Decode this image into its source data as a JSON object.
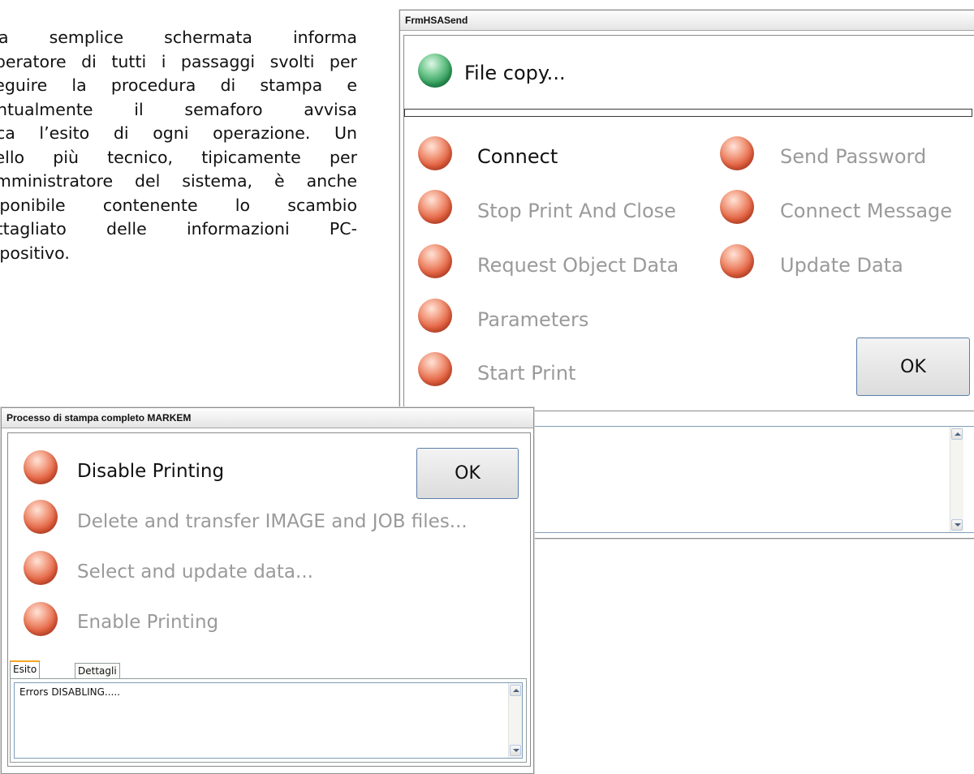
{
  "doc": {
    "lines": [
      "Una semplice schermata informa",
      "l'operatore di tutti i passaggi svolti per",
      "eseguire la procedura di stampa e",
      "puntualmente il semaforo avvisa",
      "circa l’esito di ogni operazione. Un",
      "livello più tecnico, tipicamente per",
      "l'amministratore del sistema, è anche",
      "disponibile contenente lo scambio",
      "dettagliato delle informazioni PC-",
      "dispositivo."
    ]
  },
  "hsa_window": {
    "title": "FrmHSASend",
    "file_copy": {
      "label": "File copy...",
      "status": "green"
    },
    "progress": 0,
    "steps": [
      {
        "label": "Connect",
        "state": "active"
      },
      {
        "label": "Send Password",
        "state": "dim"
      },
      {
        "label": "Stop Print And Close",
        "state": "dim"
      },
      {
        "label": "Connect Message",
        "state": "dim"
      },
      {
        "label": "Request Object Data",
        "state": "dim"
      },
      {
        "label": "Update Data",
        "state": "dim"
      },
      {
        "label": "Parameters",
        "state": "dim"
      },
      {
        "label": "Start Print",
        "state": "dim"
      }
    ],
    "ok_label": "OK",
    "log_text": ""
  },
  "markem_window": {
    "title": "Processo di stampa completo MARKEM",
    "steps": [
      {
        "label": "Disable Printing",
        "state": "active"
      },
      {
        "label": "Delete and transfer IMAGE and JOB files...",
        "state": "dim"
      },
      {
        "label": "Select and update data...",
        "state": "dim"
      },
      {
        "label": "Enable Printing",
        "state": "dim"
      }
    ],
    "ok_label": "OK",
    "tabs": [
      {
        "label": "Esito",
        "selected": true
      },
      {
        "label": "Dettagli",
        "selected": false
      }
    ],
    "log_text": "Errors DISABLING....."
  },
  "colors": {
    "led_red": "#e2603f",
    "led_green": "#2e9b58",
    "label_active": "#111111",
    "label_dim": "#9a9a9a",
    "tab_accent": "#f6a623"
  }
}
